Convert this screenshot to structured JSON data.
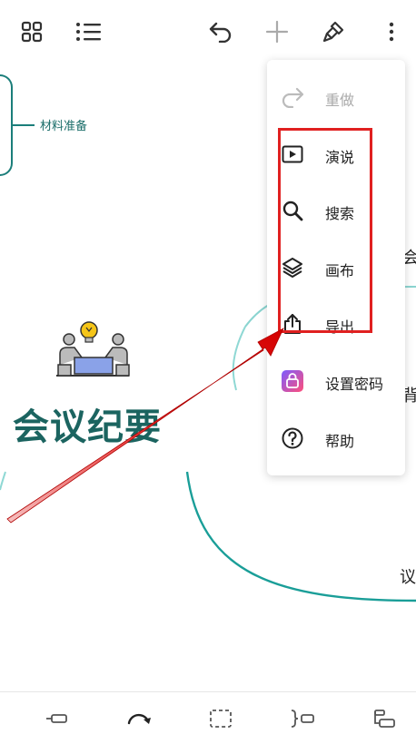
{
  "toolbar": {
    "icons": [
      "grid-icon",
      "outline-list-icon",
      "undo-icon",
      "add-icon",
      "brush-icon",
      "more-vertical-icon"
    ]
  },
  "canvas": {
    "node_label": "材料准备",
    "main_title": "会议纪要",
    "edge_texts": [
      "会",
      "背",
      "议"
    ]
  },
  "menu": {
    "items": [
      {
        "label": "重做",
        "icon": "redo-icon",
        "enabled": false
      },
      {
        "label": "演说",
        "icon": "play-icon",
        "enabled": true
      },
      {
        "label": "搜索",
        "icon": "search-icon",
        "enabled": true
      },
      {
        "label": "画布",
        "icon": "layers-icon",
        "enabled": true
      },
      {
        "label": "导出",
        "icon": "share-icon",
        "enabled": true
      },
      {
        "label": "设置密码",
        "icon": "lock-icon",
        "enabled": true
      },
      {
        "label": "帮助",
        "icon": "help-icon",
        "enabled": true
      }
    ]
  },
  "bottombar": {
    "icons": [
      "sibling-node-icon",
      "relation-line-icon",
      "boundary-icon",
      "summary-icon",
      "child-node-icon"
    ]
  },
  "colors": {
    "accent": "#1b7e7a",
    "title": "#1b6460",
    "annotation": "#e02020",
    "branch": "#29b0aa"
  }
}
